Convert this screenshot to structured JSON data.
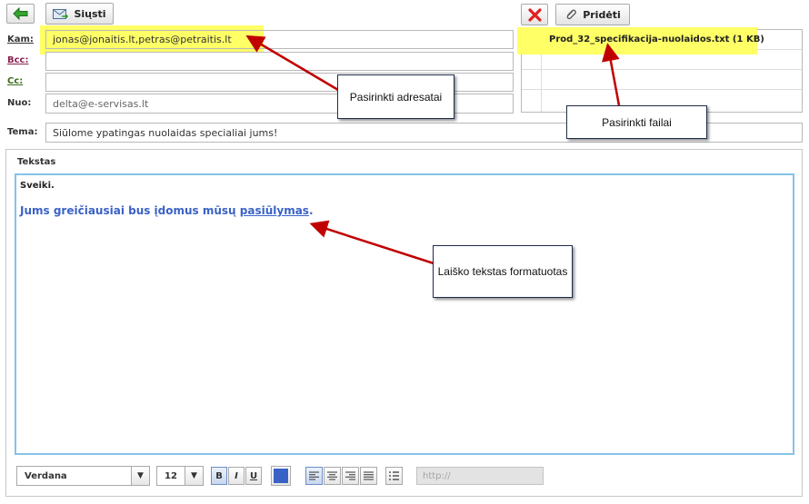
{
  "toolbar": {
    "back_icon": "arrow-left-icon",
    "send_label": "Siųsti",
    "delete_icon": "red-x-icon",
    "attach_label": "Pridėti"
  },
  "form": {
    "to_label": "Kam:",
    "to_value": "jonas@jonaitis.lt,petras@petraitis.lt",
    "bcc_label": "Bcc:",
    "bcc_value": "",
    "cc_label": "Cc:",
    "cc_value": "",
    "from_label": "Nuo:",
    "from_value": "delta@e-servisas.lt",
    "subject_label": "Tema:",
    "subject_value": "Siūlome ypatingas nuolaidas specialiai jums!"
  },
  "attachments": {
    "files": [
      "Prod_32_specifikacija-nuolaidos.txt (1 KB)"
    ]
  },
  "body": {
    "section_label": "Tekstas",
    "greeting": "Sveiki.",
    "message_before": "Jums greičiausiai bus įdomus mūsų ",
    "message_link": "pasiūlymas",
    "message_after": "."
  },
  "editor_toolbar": {
    "font": "Verdana",
    "size": "12",
    "bold": "B",
    "italic": "I",
    "underline": "U",
    "text_color": "#3a62c6",
    "link_placeholder": "http://"
  },
  "callouts": {
    "recipients": "Pasirinkti adresatai",
    "files": "Pasirinkti failai",
    "text": "Laiško tekstas formatuotas"
  },
  "colors": {
    "highlight": "#ffff66",
    "arrow": "#c00000",
    "link_blue": "#3a62c6",
    "editor_border": "#86c3e6"
  }
}
